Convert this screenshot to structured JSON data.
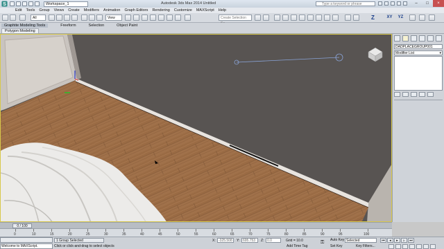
{
  "title_bar": {
    "workspace": "Workspace_1",
    "app_title": "Autodesk 3ds Max 2014   Untitled",
    "help_placeholder": "Type a keyword or phrase",
    "buttons": [
      "–",
      "□",
      "×"
    ]
  },
  "menu": [
    "Edit",
    "Tools",
    "Group",
    "Views",
    "Create",
    "Modifiers",
    "Animation",
    "Graph Editors",
    "Rendering",
    "Customize",
    "MAXScript",
    "Help"
  ],
  "toolbar": {
    "filter_value": "All",
    "view_value": "View",
    "selection_set_placeholder": "Create Selection Se",
    "axis_buttons": [
      "Z",
      "XY",
      "YZ"
    ]
  },
  "ribbon": {
    "tabs": [
      "Graphite Modeling Tools",
      "Freeform",
      "Selection",
      "Object Paint"
    ],
    "active_subtab": "Polygon Modeling"
  },
  "command_panel": {
    "object_name": "DADPLACEGROUP001",
    "modifier_list": "Modifier List"
  },
  "time_slider": {
    "current": "0 / 100"
  },
  "track": {
    "ticks": [
      "0",
      "10",
      "15",
      "20",
      "25",
      "30",
      "35",
      "40",
      "45",
      "50",
      "55",
      "60",
      "65",
      "70",
      "75",
      "80",
      "85",
      "90",
      "95",
      "100"
    ]
  },
  "status": {
    "listener_text": "Welcome to MAXScript.",
    "selection_info": "1 Group Selected",
    "prompt": "Click or click-and-drag to select objects",
    "x_label": "X:",
    "x_value": "-325.508",
    "y_label": "Y:",
    "y_value": "695.753",
    "z_label": "Z:",
    "z_value": "0.0",
    "grid": "Grid = 10.0",
    "add_time_tag": "Add Time Tag",
    "auto_key": "Auto Key",
    "set_key": "Set Key",
    "key_mode": "Selected",
    "key_filters": "Key Filters..."
  },
  "colors": {
    "wall": "#585452",
    "floor": "#a0714a",
    "viewport_border": "#d8c84a"
  }
}
